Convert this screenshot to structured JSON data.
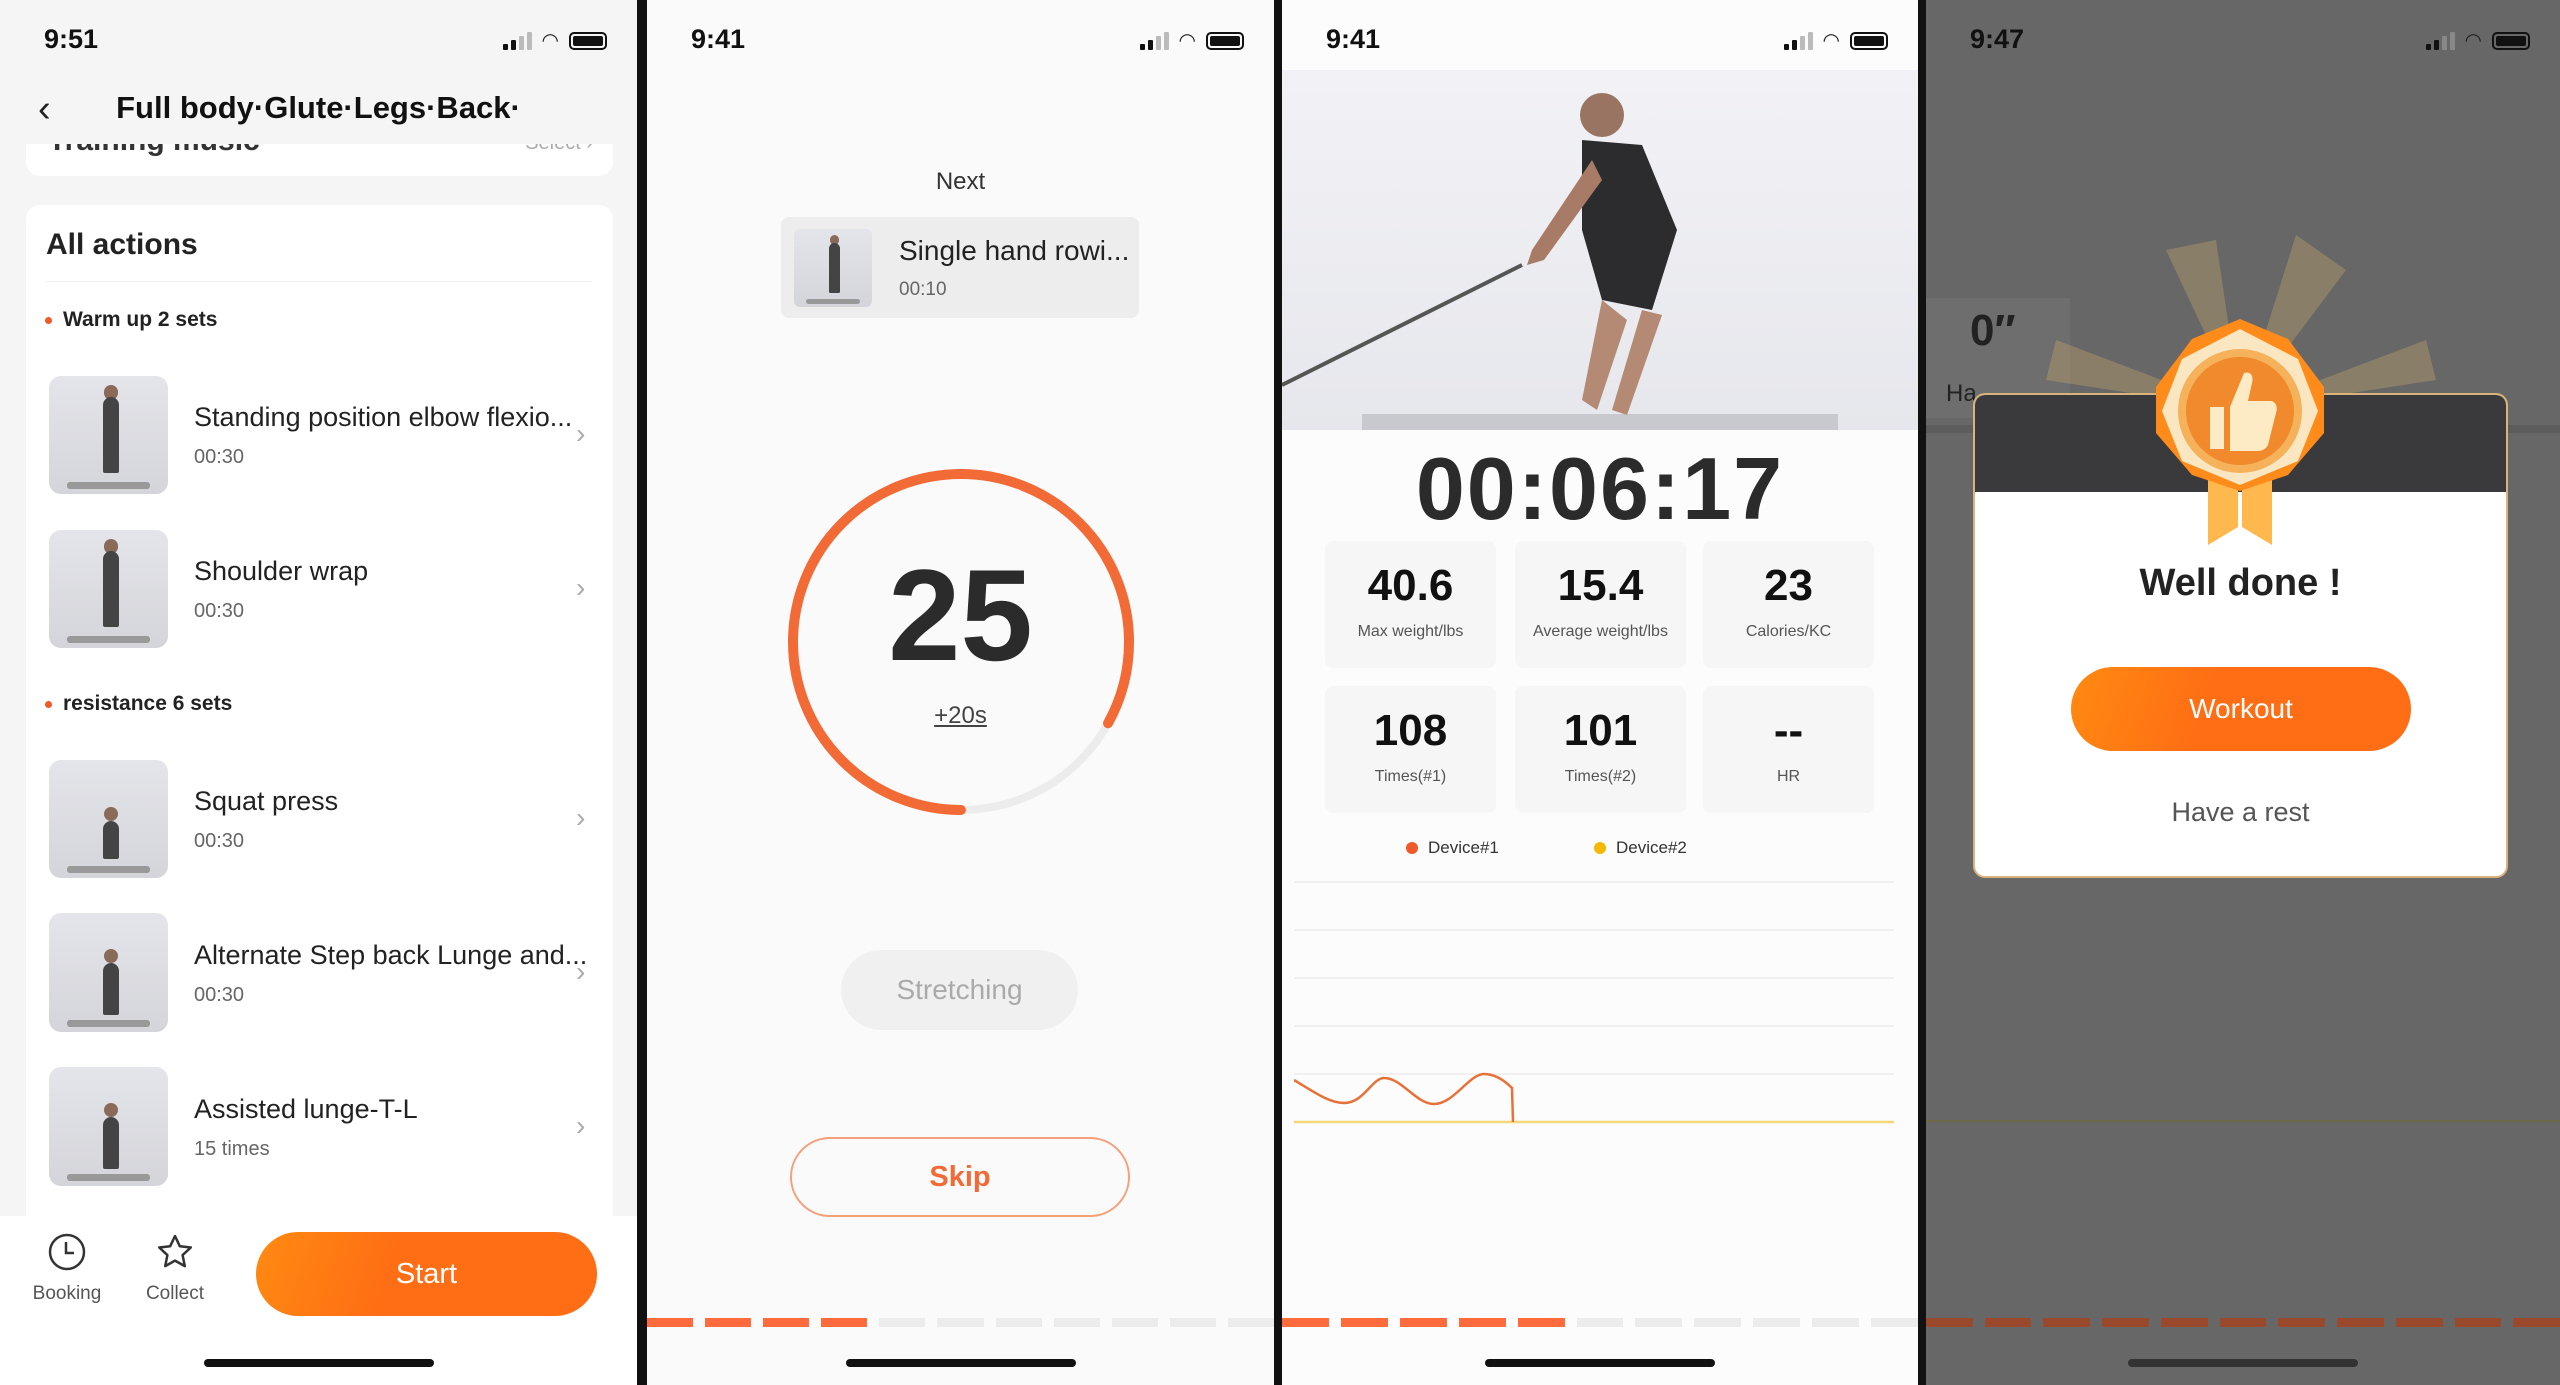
{
  "colors": {
    "accent": "#ff6f1a",
    "ring": "#f26a35",
    "device1": "#f05a28",
    "device2": "#f5b800"
  },
  "panel1": {
    "status_time": "9:51",
    "title": "Full body·Glute·Legs·Back·",
    "music_card": {
      "label": "Training music",
      "action": "Select ›"
    },
    "all_actions": "All actions",
    "sections": [
      {
        "label": "Warm up 2 sets",
        "items": [
          {
            "title": "Standing position elbow flexio...",
            "time": "00:30"
          },
          {
            "title": "Shoulder wrap",
            "time": "00:30"
          }
        ]
      },
      {
        "label": "resistance 6 sets",
        "items": [
          {
            "title": "Squat press",
            "time": "00:30"
          },
          {
            "title": "Alternate Step back Lunge and...",
            "time": "00:30"
          },
          {
            "title": "Assisted lunge-T-L",
            "time": "15 times"
          }
        ]
      }
    ],
    "bottom": {
      "booking": "Booking",
      "collect": "Collect",
      "start": "Start"
    }
  },
  "panel2": {
    "status_time": "9:41",
    "next_label": "Next",
    "next_item": {
      "title": "Single hand rowi...",
      "time": "00:10"
    },
    "countdown": "25",
    "countdown_progress": 0.83,
    "add_time": "+20s",
    "stretching": "Stretching",
    "skip": "Skip",
    "segments_total": 11,
    "segments_done": 4
  },
  "panel3": {
    "status_time": "9:41",
    "timer": "00:06:17",
    "stats": [
      {
        "value": "40.6",
        "label": "Max weight/lbs"
      },
      {
        "value": "15.4",
        "label": "Average weight/lbs"
      },
      {
        "value": "23",
        "label": "Calories/KC"
      },
      {
        "value": "108",
        "label": "Times(#1)"
      },
      {
        "value": "101",
        "label": "Times(#2)"
      },
      {
        "value": "--",
        "label": "HR"
      }
    ],
    "legend": [
      "Device#1",
      "Device#2"
    ],
    "segments_total": 11,
    "segments_done": 5
  },
  "panel4": {
    "status_time": "9:47",
    "bg_value": "0″",
    "bg_label": "Ha",
    "modal": {
      "title": "Well done !",
      "primary": "Workout",
      "secondary": "Have a rest"
    },
    "segments_total": 11,
    "segments_done": 11
  }
}
